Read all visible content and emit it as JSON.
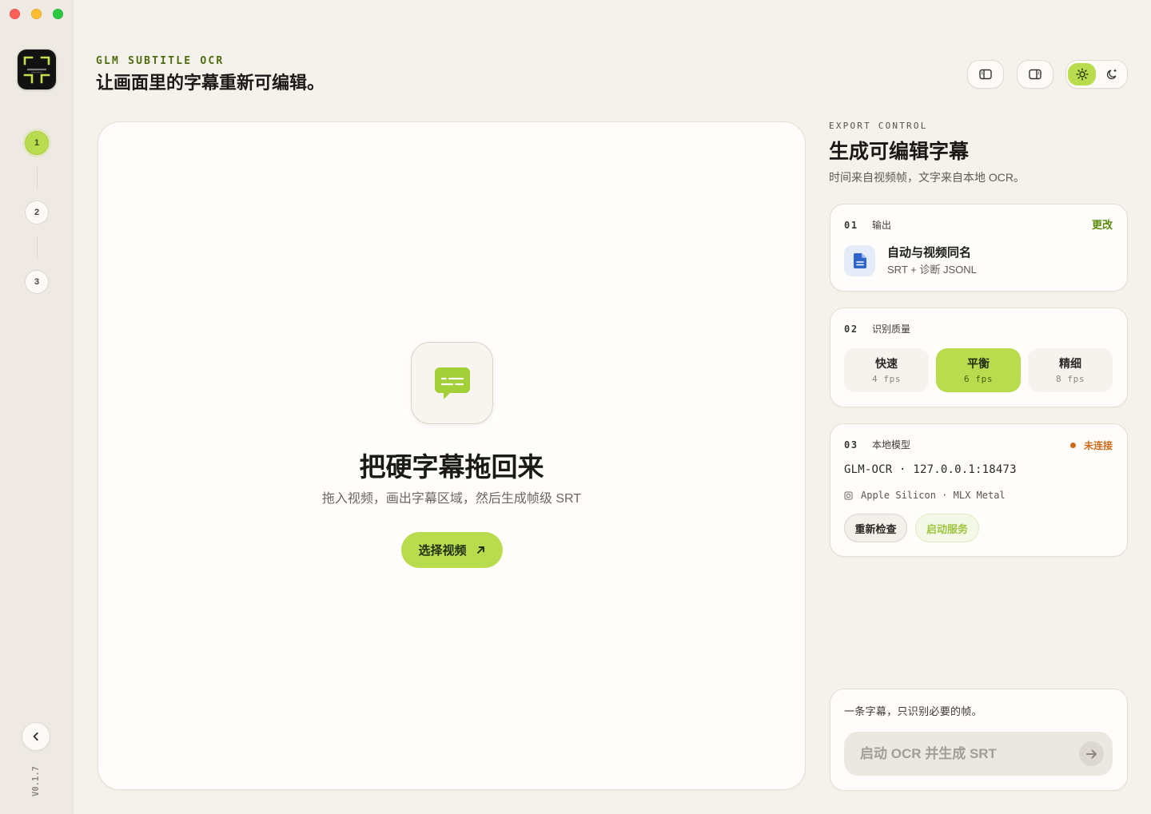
{
  "colors": {
    "accent": "#b9dc4f",
    "accent_text": "#4d6c10",
    "link": "#5c8a0d",
    "file_icon": "#2f64c8",
    "file_icon_bg": "#e5ecf7",
    "status_offline": "#cf6a17",
    "start_service": "#9dc43f",
    "traffic_close": "#ff5f57",
    "traffic_minimize": "#febc2e",
    "traffic_zoom": "#28c840"
  },
  "sidebar": {
    "logo_icon": "app-logo-icon",
    "steps": [
      {
        "label": "1",
        "active": true
      },
      {
        "label": "2",
        "active": false
      },
      {
        "label": "3",
        "active": false
      }
    ],
    "collapse_icon": "chevron-left-icon",
    "version": "V0.1.7"
  },
  "header": {
    "eyebrow": "GLM SUBTITLE OCR",
    "title": "让画面里的字幕重新可编辑。",
    "toolbar": {
      "left_panel_icon": "sidebar-left-icon",
      "right_panel_icon": "sidebar-right-icon",
      "theme": {
        "light_icon": "sun-icon",
        "dark_icon": "moon-icon",
        "light_active": true,
        "dark_active": false
      }
    }
  },
  "dropzone": {
    "icon": "subtitle-bubble-icon",
    "title": "把硬字幕拖回来",
    "subtitle": "拖入视频，画出字幕区域，然后生成帧级 SRT",
    "button": {
      "label": "选择视频",
      "icon": "arrow-up-right-icon"
    }
  },
  "panel": {
    "eyebrow": "EXPORT CONTROL",
    "title": "生成可编辑字幕",
    "subtitle": "时间来自视频帧，文字来自本地 OCR。",
    "output": {
      "index": "01",
      "label": "输出",
      "action": "更改",
      "icon": "file-icon",
      "name": "自动与视频同名",
      "formats": "SRT + 诊断 JSONL"
    },
    "quality": {
      "index": "02",
      "label": "识别质量",
      "options": [
        {
          "label": "快速",
          "fps": "4 fps",
          "active": false
        },
        {
          "label": "平衡",
          "fps": "6 fps",
          "active": true
        },
        {
          "label": "精细",
          "fps": "8 fps",
          "active": false
        }
      ]
    },
    "model": {
      "index": "03",
      "label": "本地模型",
      "status": "未连接",
      "name": "GLM-OCR",
      "separator": "·",
      "endpoint": "127.0.0.1:18473",
      "hardware_icon": "chip-icon",
      "hardware": "Apple Silicon",
      "backend": "MLX Metal",
      "recheck_label": "重新检查",
      "start_label": "启动服务"
    },
    "run": {
      "note": "一条字幕，只识别必要的帧。",
      "button_label": "启动 OCR 并生成 SRT",
      "button_icon": "arrow-right-icon",
      "disabled": true
    }
  }
}
